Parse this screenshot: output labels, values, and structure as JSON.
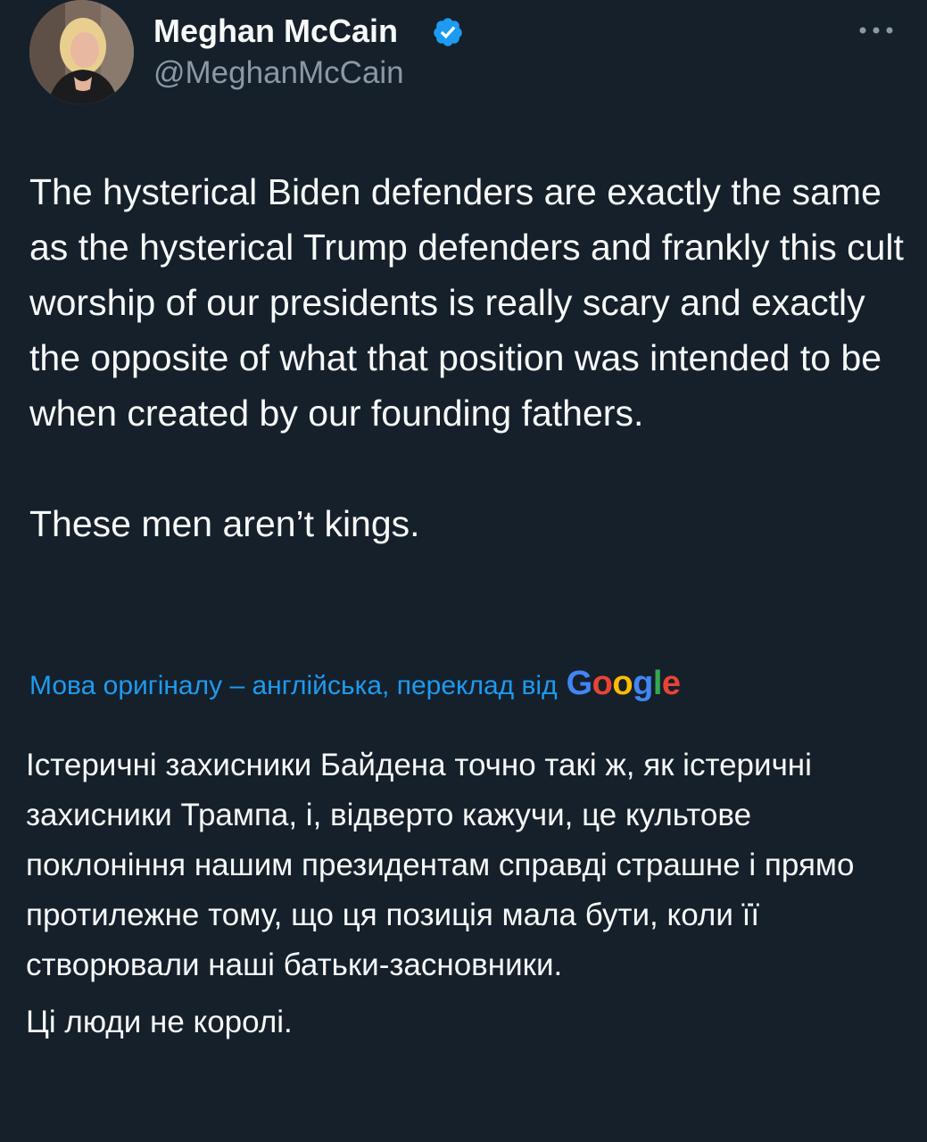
{
  "author": {
    "name": "Meghan McCain",
    "handle": "@MeghanMcCain",
    "verified": true
  },
  "icons": {
    "verified": "verified-badge-icon",
    "more": "more-options-icon"
  },
  "tweet": {
    "paragraphs": [
      "The hysterical Biden defenders are exactly the same as the hysterical Trump defenders and frankly this cult worship of our presidents is really scary and exactly the opposite of what that position was intended to be when created by our founding fathers.",
      "These men aren’t kings."
    ]
  },
  "translation": {
    "note": "Мова оригіналу – англійська, переклад від",
    "provider_letters": [
      "G",
      "o",
      "o",
      "g",
      "l",
      "e"
    ],
    "provider_colors": [
      "#4285f4",
      "#ea4335",
      "#fbbc05",
      "#4285f4",
      "#34a853",
      "#ea4335"
    ],
    "paragraphs": [
      "Істеричні захисники Байдена точно такі ж, як істеричні захисники Трампа, і, відверто кажучи, це культове поклоніння нашим президентам справді страшне і прямо протилежне тому, що ця позиція мала бути, коли її створювали наші батьки-засновники.",
      "Ці люди не королі."
    ]
  },
  "colors": {
    "background": "#15202b",
    "primary_text": "#f7f9f9",
    "secondary_text": "#8b98a5",
    "link": "#1d9bf0",
    "verified": "#1d9bf0"
  }
}
